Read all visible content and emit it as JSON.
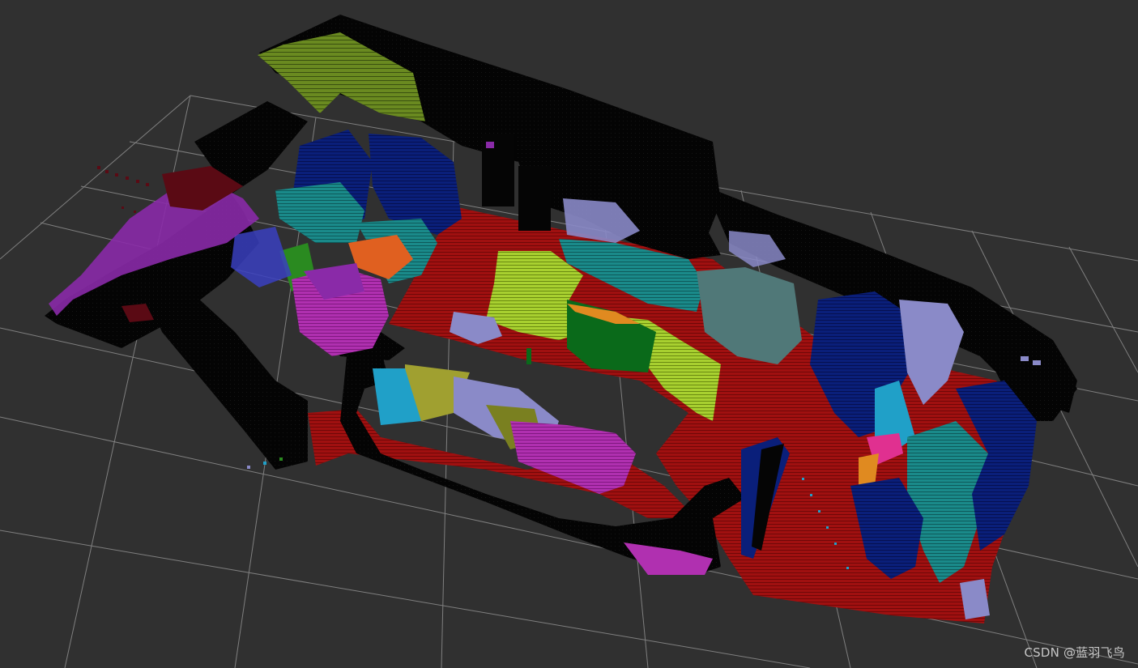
{
  "viewer": {
    "background": "#303030",
    "grid_color": "#a0a0a0"
  },
  "watermark": {
    "text": "CSDN @蓝羽飞鸟"
  },
  "segment_colors": {
    "floor": "#a01010",
    "walls": "#050505",
    "navy": "#0a1f7a",
    "blue": "#123090",
    "teal": "#1a8a8a",
    "cyan": "#20a0c8",
    "purple": "#8a2aa8",
    "magenta": "#b030b0",
    "lime": "#a8d030",
    "olive": "#6a8a20",
    "green": "#0a6a1a",
    "lavender": "#8a8ac8",
    "slate": "#507878",
    "orange": "#e06020",
    "pink": "#e03090",
    "maroon": "#5a0a14",
    "khaki": "#a0a030"
  }
}
